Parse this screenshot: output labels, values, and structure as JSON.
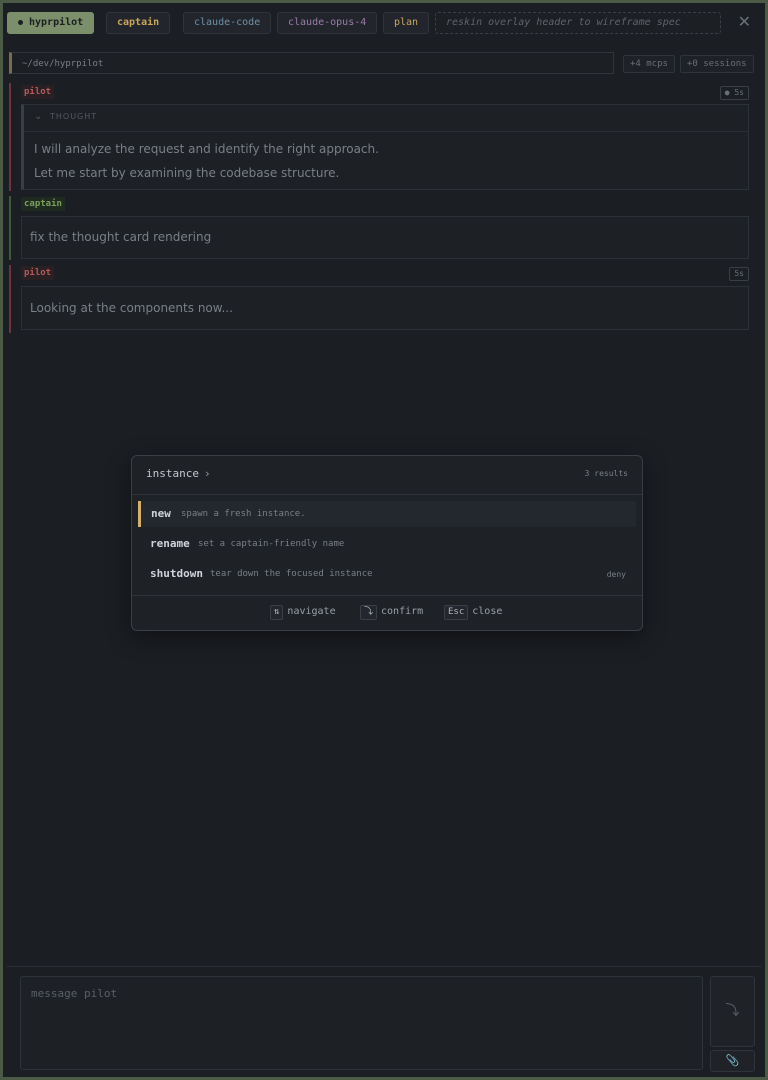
{
  "header": {
    "app_name": "hyprpilot",
    "role": "captain",
    "agent": "claude-code",
    "model": "claude-opus-4",
    "mode": "plan",
    "task": "reskin overlay header to wireframe spec",
    "close_glyph": "✕"
  },
  "path": {
    "cwd": "~/dev/hyprpilot",
    "mcps": "+4 mcps",
    "sessions": "+0 sessions"
  },
  "transcript": [
    {
      "speaker": "pilot",
      "duration": "● 5s",
      "thought_label": "THOUGHT",
      "thought_lines": [
        "I will analyze the request and identify the right approach.",
        "Let me start by examining the codebase structure."
      ]
    },
    {
      "speaker": "captain",
      "text": "fix the thought card rendering"
    },
    {
      "speaker": "pilot",
      "duration": "5s",
      "text": "Looking at the components now..."
    }
  ],
  "palette": {
    "query": "instance",
    "caret": "›",
    "count": "3 results",
    "options": [
      {
        "name": "new",
        "desc": "spawn a fresh instance.",
        "badge": ""
      },
      {
        "name": "rename",
        "desc": "set a captain-friendly name",
        "badge": ""
      },
      {
        "name": "shutdown",
        "desc": "tear down the focused instance",
        "badge": "deny"
      }
    ],
    "hints": [
      {
        "key": "⇅",
        "label": "navigate"
      },
      {
        "key": "⤵",
        "label": "confirm"
      },
      {
        "key": "Esc",
        "label": "close"
      }
    ]
  },
  "composer": {
    "placeholder": "message pilot",
    "send_glyph": "⤵",
    "attach_glyph": "📎"
  }
}
